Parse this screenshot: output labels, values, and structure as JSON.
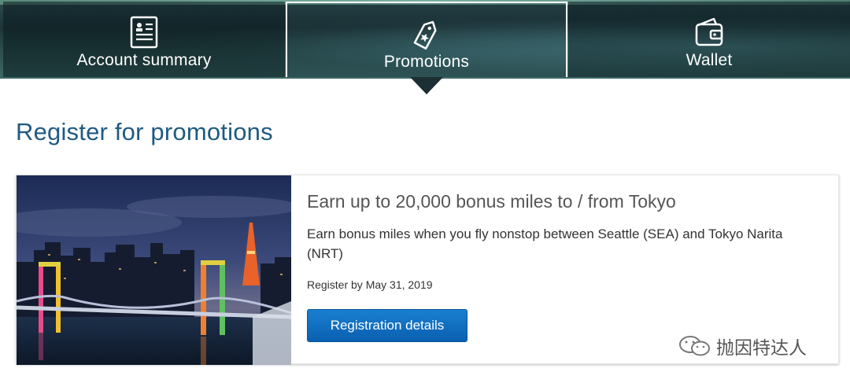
{
  "tabs": [
    {
      "label": "Account summary",
      "icon": "account-summary-icon",
      "active": false
    },
    {
      "label": "Promotions",
      "icon": "promotion-tag-icon",
      "active": true
    },
    {
      "label": "Wallet",
      "icon": "wallet-icon",
      "active": false
    }
  ],
  "section": {
    "title": "Register for promotions"
  },
  "promo": {
    "image": "tokyo-rainbow-bridge-photo",
    "title": "Earn up to 20,000 bonus miles to / from Tokyo",
    "description": "Earn bonus miles when you fly nonstop between Seattle (SEA) and Tokyo Narita (NRT)",
    "register_by": "Register by May 31, 2019",
    "button_label": "Registration details"
  },
  "watermark": {
    "text": "抛因特达人",
    "icon": "wechat-icon"
  },
  "colors": {
    "title_blue": "#1f5a82",
    "button_blue": "#0a6bc0"
  }
}
